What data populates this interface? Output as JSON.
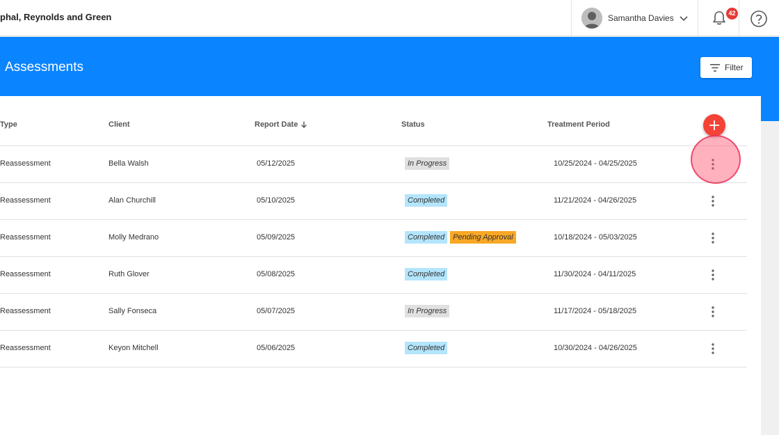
{
  "header": {
    "org_name": "phal, Reynolds and Green",
    "user_name": "Samantha Davies",
    "notification_count": "42",
    "icons": {
      "avatar": "user-avatar",
      "dropdown": "chevron-down-icon",
      "notifications": "bell-icon",
      "help": "help-circle-icon"
    }
  },
  "banner": {
    "title": "Assessments",
    "filter_label": "Filter",
    "color": "#0a84ff"
  },
  "table": {
    "columns": {
      "type": "Type",
      "client": "Client",
      "report_date": "Report Date",
      "status": "Status",
      "treatment_period": "Treatment Period"
    },
    "sort": {
      "column": "report_date",
      "direction": "descending"
    },
    "rows": [
      {
        "type": "Reassessment",
        "client": "Bella Walsh",
        "report_date": "05/12/2025",
        "statuses": [
          "In Progress"
        ],
        "treatment_period": "10/25/2024 - 04/25/2025"
      },
      {
        "type": "Reassessment",
        "client": "Alan Churchill",
        "report_date": "05/10/2025",
        "statuses": [
          "Completed"
        ],
        "treatment_period": "11/21/2024 - 04/26/2025"
      },
      {
        "type": "Reassessment",
        "client": "Molly Medrano",
        "report_date": "05/09/2025",
        "statuses": [
          "Completed",
          "Pending Approval"
        ],
        "treatment_period": "10/18/2024 - 05/03/2025"
      },
      {
        "type": "Reassessment",
        "client": "Ruth Glover",
        "report_date": "05/08/2025",
        "statuses": [
          "Completed"
        ],
        "treatment_period": "11/30/2024 - 04/11/2025"
      },
      {
        "type": "Reassessment",
        "client": "Sally Fonseca",
        "report_date": "05/07/2025",
        "statuses": [
          "In Progress"
        ],
        "treatment_period": "11/17/2024 - 05/18/2025"
      },
      {
        "type": "Reassessment",
        "client": "Keyon Mitchell",
        "report_date": "05/06/2025",
        "statuses": [
          "Completed"
        ],
        "treatment_period": "10/30/2024 - 04/26/2025"
      }
    ]
  },
  "status_colors": {
    "In Progress": "#e0e0e0",
    "Completed": "#b3e5fc",
    "Pending Approval": "#f9a825"
  },
  "accent_colors": {
    "add_button": "#f44336",
    "badge": "#e53935"
  }
}
